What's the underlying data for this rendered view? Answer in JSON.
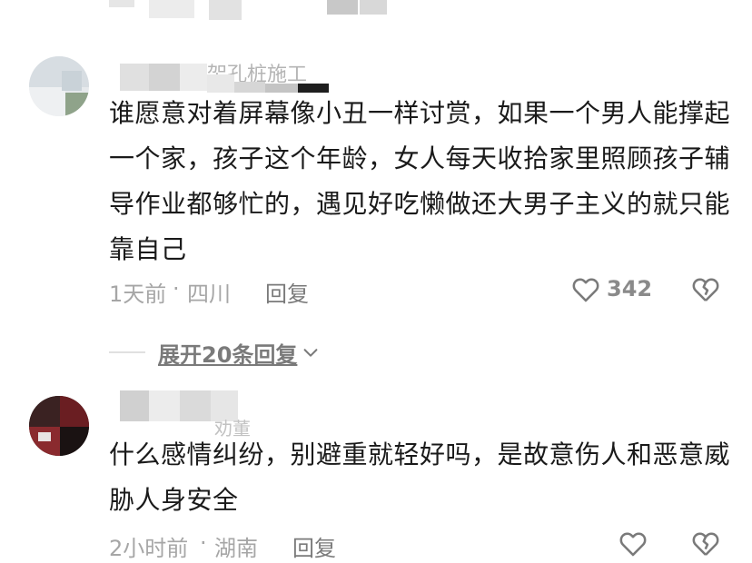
{
  "top_fragment": {
    "blurred": true
  },
  "comments": [
    {
      "username_partial": "架孔桩施工",
      "text": "谁愿意对着屏幕像小丑一样讨赏，如果一个男人能撑起一个家，孩子这个年龄，女人每天收拾家里照顾孩子辅导作业都够忙的，遇见好吃懒做还大男子主义的就只能靠自己",
      "time": "1天前",
      "separator": "·",
      "location": "四川",
      "reply_label": "回复",
      "like_count": "342"
    },
    {
      "username_partial": "劝董",
      "text": "什么感情纠纷，别避重就轻好吗，是故意伤人和恶意威胁人身安全",
      "time": "2小时前",
      "separator": "·",
      "location": "湖南",
      "reply_label": "回复",
      "like_count": ""
    }
  ],
  "expand_replies": {
    "label": "展开20条回复",
    "chevron": "chevron-down-icon"
  },
  "icons": {
    "like": "heart-outline-icon",
    "dislike": "broken-heart-icon"
  },
  "colors": {
    "text": "#1a1a1a",
    "meta": "#a6a6a6",
    "icon": "#7a7a7a"
  }
}
